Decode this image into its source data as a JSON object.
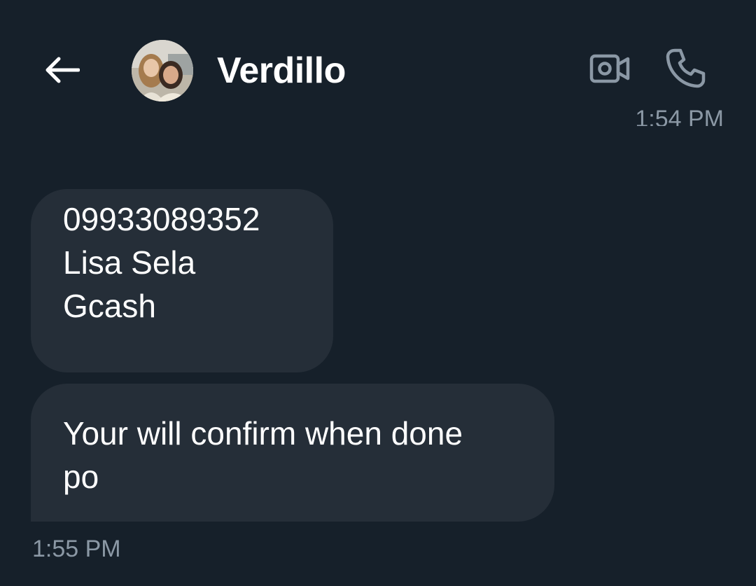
{
  "header": {
    "back_icon": "arrow-left-icon",
    "contact_name": "Verdillo",
    "avatar": "contact-avatar-photo",
    "video_icon": "video-camera-icon",
    "call_icon": "phone-icon"
  },
  "messages": {
    "top_timestamp": "1:54 PM",
    "bubbles": [
      {
        "lines": [
          "09933089352",
          "Lisa Sela",
          "Gcash"
        ]
      },
      {
        "lines": [
          "Your will confirm when done",
          "po"
        ]
      }
    ],
    "bottom_timestamp": "1:55 PM"
  },
  "colors": {
    "background": "#16202a",
    "bubble": "#252e38",
    "muted_text": "#8b98a5",
    "text": "#ffffff"
  }
}
